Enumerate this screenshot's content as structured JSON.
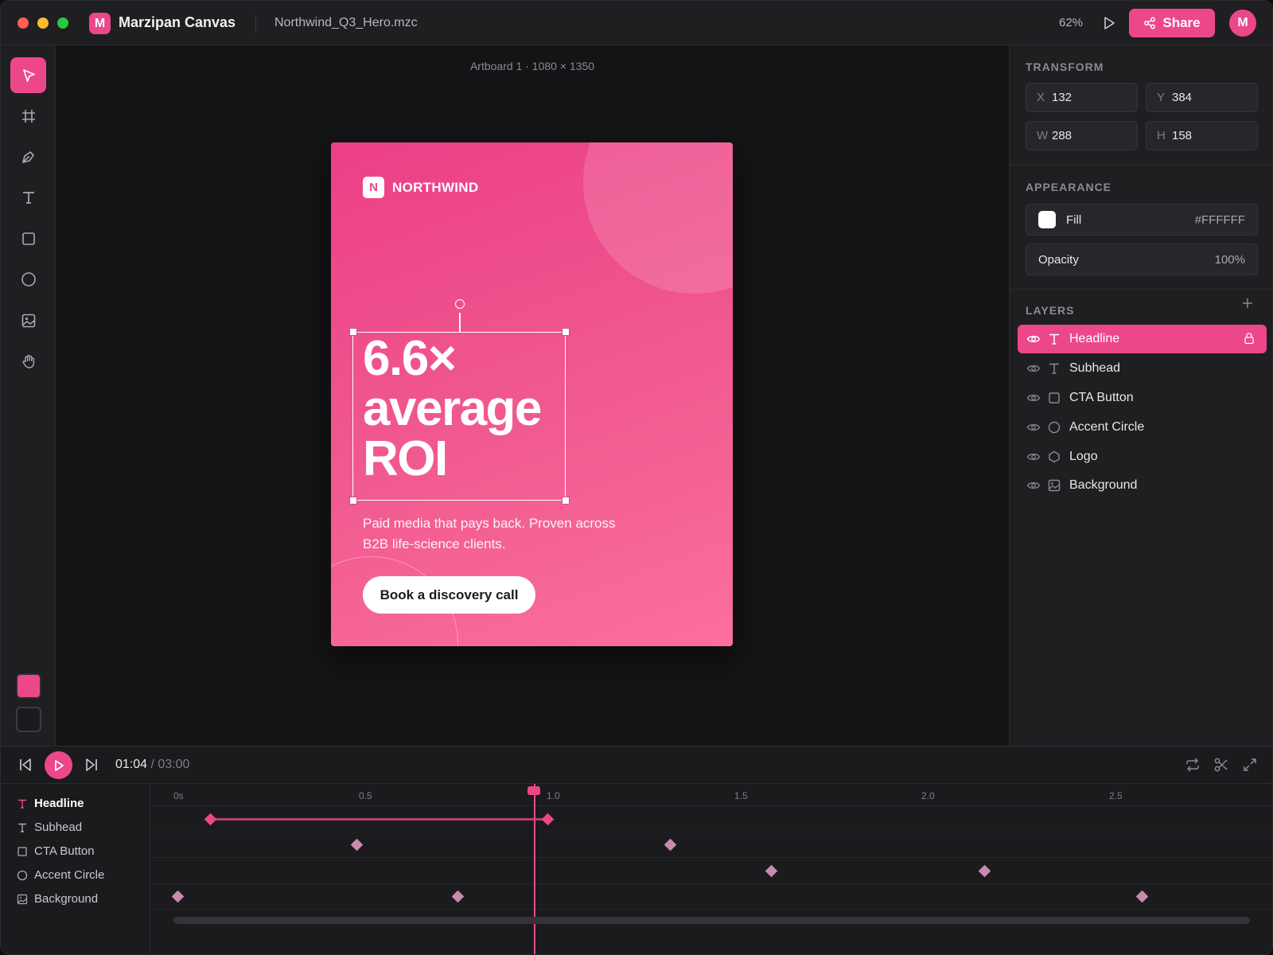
{
  "app": {
    "logo_letter": "M",
    "title": "Marzipan Canvas",
    "file_name": "Northwind_Q3_Hero.mzc",
    "zoom": "62%",
    "share_label": "Share",
    "avatar_initial": "M"
  },
  "toolbar": {
    "tools": [
      "select-icon",
      "frame-icon",
      "pen-icon",
      "text-icon",
      "rectangle-icon",
      "ellipse-icon",
      "image-icon",
      "hand-icon"
    ],
    "active_tool": "select-icon",
    "fill_color": "#EC4889"
  },
  "canvas": {
    "artboard_label": "Artboard 1 · 1080 × 1350",
    "artboard": {
      "brand_mark": "N",
      "brand_name": "NORTHWIND",
      "headline": [
        "6.6×",
        "average",
        "ROI"
      ],
      "subhead": "Paid media that pays back. Proven across B2B life-science clients.",
      "cta": "Book a discovery call"
    }
  },
  "panel": {
    "transform": {
      "title": "TRANSFORM",
      "x_label": "X",
      "x": "132",
      "y_label": "Y",
      "y": "384",
      "w_label": "W",
      "w": "288",
      "h_label": "H",
      "h": "158"
    },
    "appearance": {
      "title": "APPEARANCE",
      "fill_label": "Fill",
      "fill_value": "#FFFFFF",
      "opacity_label": "Opacity",
      "opacity_value": "100%"
    },
    "layers": {
      "title": "LAYERS",
      "items": [
        {
          "name": "Headline",
          "type": "text-icon",
          "selected": true,
          "locked": true
        },
        {
          "name": "Subhead",
          "type": "text-icon"
        },
        {
          "name": "CTA Button",
          "type": "rectangle-icon"
        },
        {
          "name": "Accent Circle",
          "type": "ellipse-icon"
        },
        {
          "name": "Logo",
          "type": "hexagon-icon"
        },
        {
          "name": "Background",
          "type": "image-icon"
        }
      ]
    }
  },
  "timeline": {
    "current_time": "01:04",
    "total_time": "/ 03:00",
    "ruler": [
      "0s",
      "0.5",
      "1.0",
      "1.5",
      "2.0",
      "2.5"
    ],
    "tracks": [
      "Headline",
      "Subhead",
      "CTA Button",
      "Accent Circle",
      "Background"
    ],
    "accent_color": "#EC4889"
  }
}
